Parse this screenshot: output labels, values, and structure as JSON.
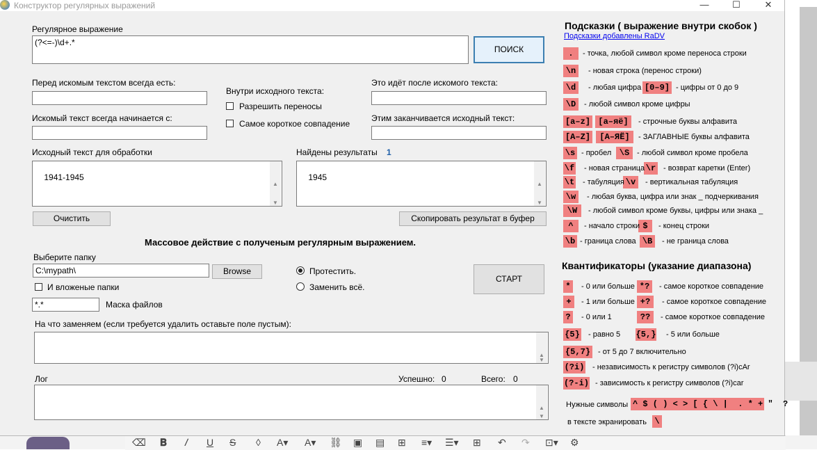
{
  "window": {
    "title": "Конструктор регулярных выражений",
    "minimize": "—",
    "maximize": "☐",
    "close": "✕"
  },
  "regex": {
    "label": "Регулярное выражение",
    "value": "(?<=-)\\d+.*",
    "search_button": "ПОИСК"
  },
  "before": {
    "label": "Перед искомым текстом всегда есть:",
    "value": ""
  },
  "starts": {
    "label": "Искомый текст всегда начинается с:",
    "value": ""
  },
  "inside": {
    "label": "Внутри исходного текста:",
    "allow_breaks": "Разрешить переносы",
    "shortest": "Самое короткое совпадение"
  },
  "after": {
    "label": "Это идёт после искомого текста:",
    "value": ""
  },
  "ends": {
    "label": "Этим заканчивается исходный текст:",
    "value": ""
  },
  "source": {
    "label": "Исходный текст для обработки",
    "value": "1941-1945",
    "clear_button": "Очистить"
  },
  "results": {
    "label": "Найдены результаты",
    "count": "1",
    "value": "1945",
    "copy_button": "Скопировать результат в буфер"
  },
  "mass": {
    "title": "Массовое действие с полученым регулярным выражением.",
    "folder_label": "Выберите папку",
    "folder_value": "C:\\mypath\\",
    "browse_button": "Browse",
    "subfolders": "И вложеные папки",
    "mask_value": "*.*",
    "mask_label": "Маска файлов",
    "test_radio": "Протестить.",
    "replace_radio": "Заменить всё.",
    "start_button": "СТАРТ",
    "replace_label": "На что заменяем (если требуется удалить оставьте поле пустым):",
    "log_label": "Лог",
    "success_label": "Успешно:",
    "success_count": "0",
    "total_label": "Всего:",
    "total_count": "0"
  },
  "hints": {
    "title": "Подсказки ( выражение внутри скобок )",
    "credit": "Подсказки добавлены RaDV",
    "rows": [
      {
        "tags": [
          "."
        ],
        "texts": [
          "- точка, любой символ кроме переноса строки"
        ]
      },
      {
        "tags": [
          "\\n"
        ],
        "texts": [
          "- новая строка (перенос строки)"
        ]
      },
      {
        "tags": [
          "\\d",
          "[0–9]"
        ],
        "texts": [
          "- любая цифра",
          "- цифры от 0 до 9"
        ]
      },
      {
        "tags": [
          "\\D"
        ],
        "texts": [
          "- любой символ кроме цифры"
        ]
      },
      {
        "tags": [
          "[a–z]",
          "[а–яё]"
        ],
        "texts": [
          "- строчные буквы алфавита"
        ]
      },
      {
        "tags": [
          "[A–Z]",
          "[А–ЯЁ]"
        ],
        "texts": [
          "- ЗАГЛАВНЫЕ буквы алфавита"
        ]
      },
      {
        "tags": [
          "\\s",
          "\\S"
        ],
        "texts": [
          "- пробел",
          "- любой символ кроме пробела"
        ]
      },
      {
        "tags": [
          "\\f",
          "\\r"
        ],
        "texts": [
          "- новая страница",
          "- возврат каретки (Enter)"
        ]
      },
      {
        "tags": [
          "\\t",
          "\\v"
        ],
        "texts": [
          "- табуляция",
          "- вертикальная табуляция"
        ]
      },
      {
        "tags": [
          "\\w"
        ],
        "texts": [
          "- любая буква, цифра или знак _ подчеркивания"
        ]
      },
      {
        "tags": [
          "\\W"
        ],
        "texts": [
          "- любой символ кроме буквы, цифры или знака _"
        ]
      },
      {
        "tags": [
          "^",
          "$"
        ],
        "texts": [
          "- начало строки",
          "- конец строки"
        ]
      },
      {
        "tags": [
          "\\b",
          "\\B"
        ],
        "texts": [
          "- граница слова",
          "- не граница слова"
        ]
      }
    ]
  },
  "quant": {
    "title": "Квантификаторы (указание диапазона)",
    "rows": [
      {
        "tags": [
          "*",
          "*?"
        ],
        "texts": [
          "- 0 или больше",
          "- самое короткое совпадение"
        ]
      },
      {
        "tags": [
          "+",
          "+?"
        ],
        "texts": [
          "- 1 или больше",
          "- самое короткое совпадение"
        ]
      },
      {
        "tags": [
          "?",
          "??"
        ],
        "texts": [
          "- 0 или 1",
          "- самое короткое совпадение"
        ]
      },
      {
        "tags": [
          "{5}",
          "{5,}"
        ],
        "texts": [
          "- равно 5",
          "- 5 или больше"
        ]
      },
      {
        "tags": [
          "{5,7}"
        ],
        "texts": [
          "- от 5 до 7 включительно"
        ]
      },
      {
        "tags": [
          "(?i)"
        ],
        "texts": [
          "- независимость к регистру символов (?i)cAr"
        ]
      },
      {
        "tags": [
          "(?-i)"
        ],
        "texts": [
          "- зависимость к регистру символов (?i)car"
        ]
      }
    ],
    "needed_label": "Нужные символы",
    "needed_symbols": "^ $ ( ) < > [ { \\ |  . * + \"  ?",
    "escape_label": "в тексте экранировать",
    "escape_symbol": "\\"
  }
}
